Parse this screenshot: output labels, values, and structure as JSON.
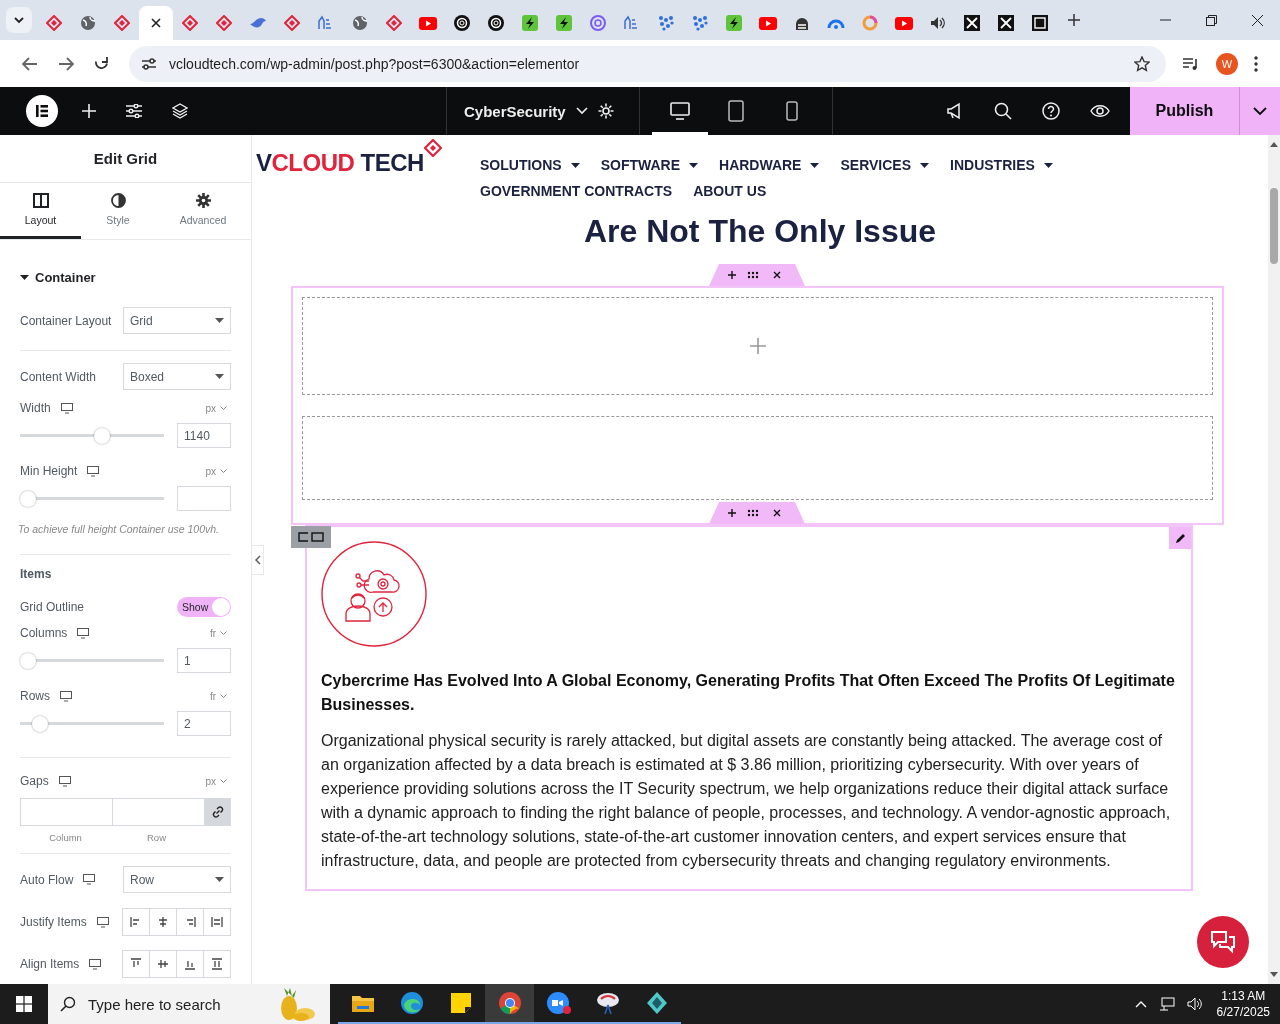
{
  "browser": {
    "tabs": [
      {
        "kind": "diamond",
        "selected": false
      },
      {
        "kind": "globe",
        "selected": false
      },
      {
        "kind": "diamond",
        "selected": false
      },
      {
        "selected": true
      },
      {
        "kind": "diamond",
        "selected": false
      },
      {
        "kind": "diamond",
        "selected": false
      },
      {
        "kind": "bird",
        "selected": false
      },
      {
        "kind": "diamond",
        "selected": false
      },
      {
        "kind": "hands",
        "selected": false
      },
      {
        "kind": "globe",
        "selected": false
      },
      {
        "kind": "diamond",
        "selected": false
      },
      {
        "kind": "video",
        "selected": false
      },
      {
        "kind": "knot",
        "selected": false
      },
      {
        "kind": "knot",
        "selected": false
      },
      {
        "kind": "bolt",
        "selected": false
      },
      {
        "kind": "bolt",
        "selected": false
      },
      {
        "kind": "swirl",
        "selected": false
      },
      {
        "kind": "hands",
        "selected": false
      },
      {
        "kind": "dots",
        "selected": false
      },
      {
        "kind": "dots",
        "selected": false
      },
      {
        "kind": "bolt",
        "selected": false
      },
      {
        "kind": "video",
        "selected": false
      },
      {
        "kind": "lock",
        "selected": false
      },
      {
        "kind": "gauge",
        "selected": false
      },
      {
        "kind": "ring",
        "selected": false
      },
      {
        "kind": "video",
        "selected": false
      },
      {
        "kind": "speaker",
        "selected": false
      },
      {
        "kind": "cross",
        "selected": false
      },
      {
        "kind": "cross",
        "selected": false
      },
      {
        "kind": "frame",
        "selected": false
      }
    ],
    "url": "vcloudtech.com/wp-admin/post.php?post=6300&action=elementor",
    "profile_initial": "W"
  },
  "editor_bar": {
    "page_title": "CyberSecurity",
    "devices": [
      {
        "kind": "desktop",
        "selected": true
      },
      {
        "kind": "tablet",
        "selected": false
      },
      {
        "kind": "mobile",
        "selected": false
      }
    ],
    "publish": "Publish"
  },
  "panel": {
    "title": "Edit Grid",
    "tabs": [
      {
        "kind": "layout",
        "label": "Layout",
        "selected": true
      },
      {
        "kind": "style",
        "label": "Style",
        "selected": false
      },
      {
        "kind": "advanced",
        "label": "Advanced",
        "selected": false
      }
    ],
    "section": {
      "title": "Container",
      "expanded": true
    },
    "controls": [
      {
        "kind": "select",
        "label": "Container Layout",
        "value": "Grid"
      },
      {
        "kind": "divider"
      },
      {
        "kind": "select",
        "label": "Content Width",
        "value": "Boxed"
      },
      {
        "kind": "slider",
        "label": "Width",
        "responsive": true,
        "unit": "px",
        "level": 0.58,
        "value": "1140"
      },
      {
        "kind": "slider",
        "label": "Min Height",
        "responsive": true,
        "unit": "px",
        "level": 0
      },
      {
        "kind": "note",
        "text": "To achieve full height Container use 100vh."
      },
      {
        "kind": "divider"
      },
      {
        "kind": "heading",
        "text": "Items"
      },
      {
        "kind": "toggle",
        "label": "Grid Outline",
        "on": true,
        "text": "Show"
      },
      {
        "kind": "slider",
        "label": "Columns",
        "responsive": true,
        "unit": "fr",
        "level": 0,
        "value": "1"
      },
      {
        "kind": "slider",
        "label": "Rows",
        "responsive": true,
        "unit": "fr",
        "level": 0.09,
        "value": "2"
      },
      {
        "kind": "divider"
      },
      {
        "kind": "gaps",
        "label": "Gaps",
        "responsive": true,
        "unit": "px",
        "captions": [
          "Column",
          "Row"
        ]
      },
      {
        "kind": "divider"
      },
      {
        "kind": "select",
        "label": "Auto Flow",
        "responsive": true,
        "value": "Row"
      },
      {
        "kind": "buttons",
        "label": "Justify Items",
        "responsive": true,
        "options": [
          {
            "kind": "start"
          },
          {
            "kind": "center"
          },
          {
            "kind": "end"
          },
          {
            "kind": "stretch"
          }
        ]
      },
      {
        "kind": "buttons",
        "label": "Align Items",
        "responsive": true,
        "options": [
          {
            "kind": "top"
          },
          {
            "kind": "middle"
          },
          {
            "kind": "bottom"
          },
          {
            "kind": "fill"
          }
        ]
      }
    ]
  },
  "page": {
    "logo": [
      {
        "text": "V",
        "color": "#1b2140"
      },
      {
        "text": "CLOUD",
        "color": "#e0243c"
      },
      {
        "text": " TECH",
        "color": "#1b2140"
      }
    ],
    "nav": [
      {
        "label": "SOLUTIONS",
        "has_menu": true
      },
      {
        "label": "SOFTWARE",
        "has_menu": true
      },
      {
        "label": "HARDWARE",
        "has_menu": true
      },
      {
        "label": "SERVICES",
        "has_menu": true
      },
      {
        "label": "INDUSTRIES",
        "has_menu": true
      },
      {
        "label": "GOVERNMENT CONTRACTS",
        "has_menu": false
      },
      {
        "label": "ABOUT US",
        "has_menu": false
      }
    ],
    "heading": "Are Not The Only Issue",
    "card": {
      "title": "Cybercrime Has Evolved Into A Global Economy, Generating Profits That Often Exceed The Profits Of Legitimate Businesses.",
      "body": "Organizational physical security is rarely attacked, but digital assets are constantly being attacked. The average cost of an organization affected by a data breach is estimated at $ 3.86 million, prioritizing cybersecurity. With over years of experience providing solutions across the IT Security spectrum, we help organizations reduce their digital attack surface with a dynamic approach to finding the right balance of people, processes, and technology. A vendor-agnostic approach, state-of-the-art technology solutions, state-of-the-art customer innovation centers, and expert services ensure that infrastructure, data, and people are protected from cybersecurity threats and changing regulatory environments."
    }
  },
  "taskbar": {
    "placeholder": "Type here to search",
    "apps": [
      {
        "kind": "folder",
        "active": false
      },
      {
        "kind": "wave",
        "active": false
      },
      {
        "kind": "note",
        "active": false
      },
      {
        "kind": "browser",
        "active": true
      },
      {
        "kind": "meet",
        "active": false
      },
      {
        "kind": "orb",
        "active": false
      },
      {
        "kind": "gem",
        "active": false
      }
    ],
    "time": "1:13 AM",
    "date": "6/27/2025"
  }
}
